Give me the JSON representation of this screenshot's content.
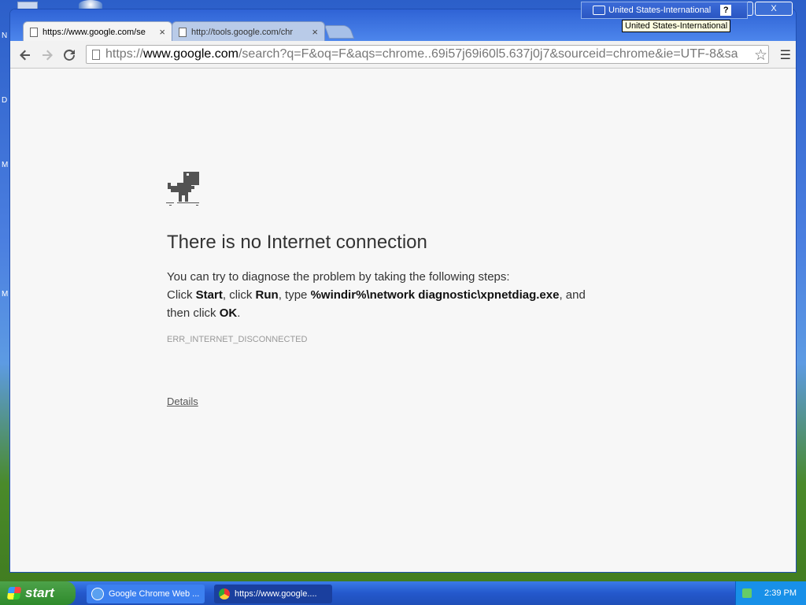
{
  "desktop": {
    "edge_letters": [
      "N",
      "D",
      "M",
      "M"
    ]
  },
  "browser": {
    "tabs": [
      {
        "label": "https://www.google.com/se",
        "active": true
      },
      {
        "label": "http://tools.google.com/chr",
        "active": false
      }
    ],
    "close_glyph": "×",
    "window_buttons": {
      "minimize": "–",
      "restore": "▫",
      "close": "X"
    },
    "omnibox": {
      "scheme": "https://",
      "host": "www.google.com",
      "path": "/search?q=F&oq=F&aqs=chrome..69i57j69i60l5.637j0j7&sourceid=chrome&ie=UTF-8&sa"
    }
  },
  "error_page": {
    "title": "There is no Internet connection",
    "intro": "You can try to diagnose the problem by taking the following steps:",
    "step_click": "Click ",
    "step_start": "Start",
    "step_click2": ", click ",
    "step_run": "Run",
    "step_type": ", type ",
    "step_command": "%windir%\\network diagnostic\\xpnetdiag.exe",
    "step_and": ", and",
    "step_then": "then click ",
    "step_ok": "OK",
    "step_end": ".",
    "error_code": "ERR_INTERNET_DISCONNECTED",
    "details_link": "Details"
  },
  "language_bar": {
    "language": "United States-International",
    "help": "?",
    "tooltip": "United States-International"
  },
  "taskbar": {
    "start_label": "start",
    "tasks": [
      {
        "label": "Google Chrome Web ...",
        "active": false
      },
      {
        "label": "https://www.google....",
        "active": true
      }
    ],
    "clock": "2:39 PM"
  }
}
